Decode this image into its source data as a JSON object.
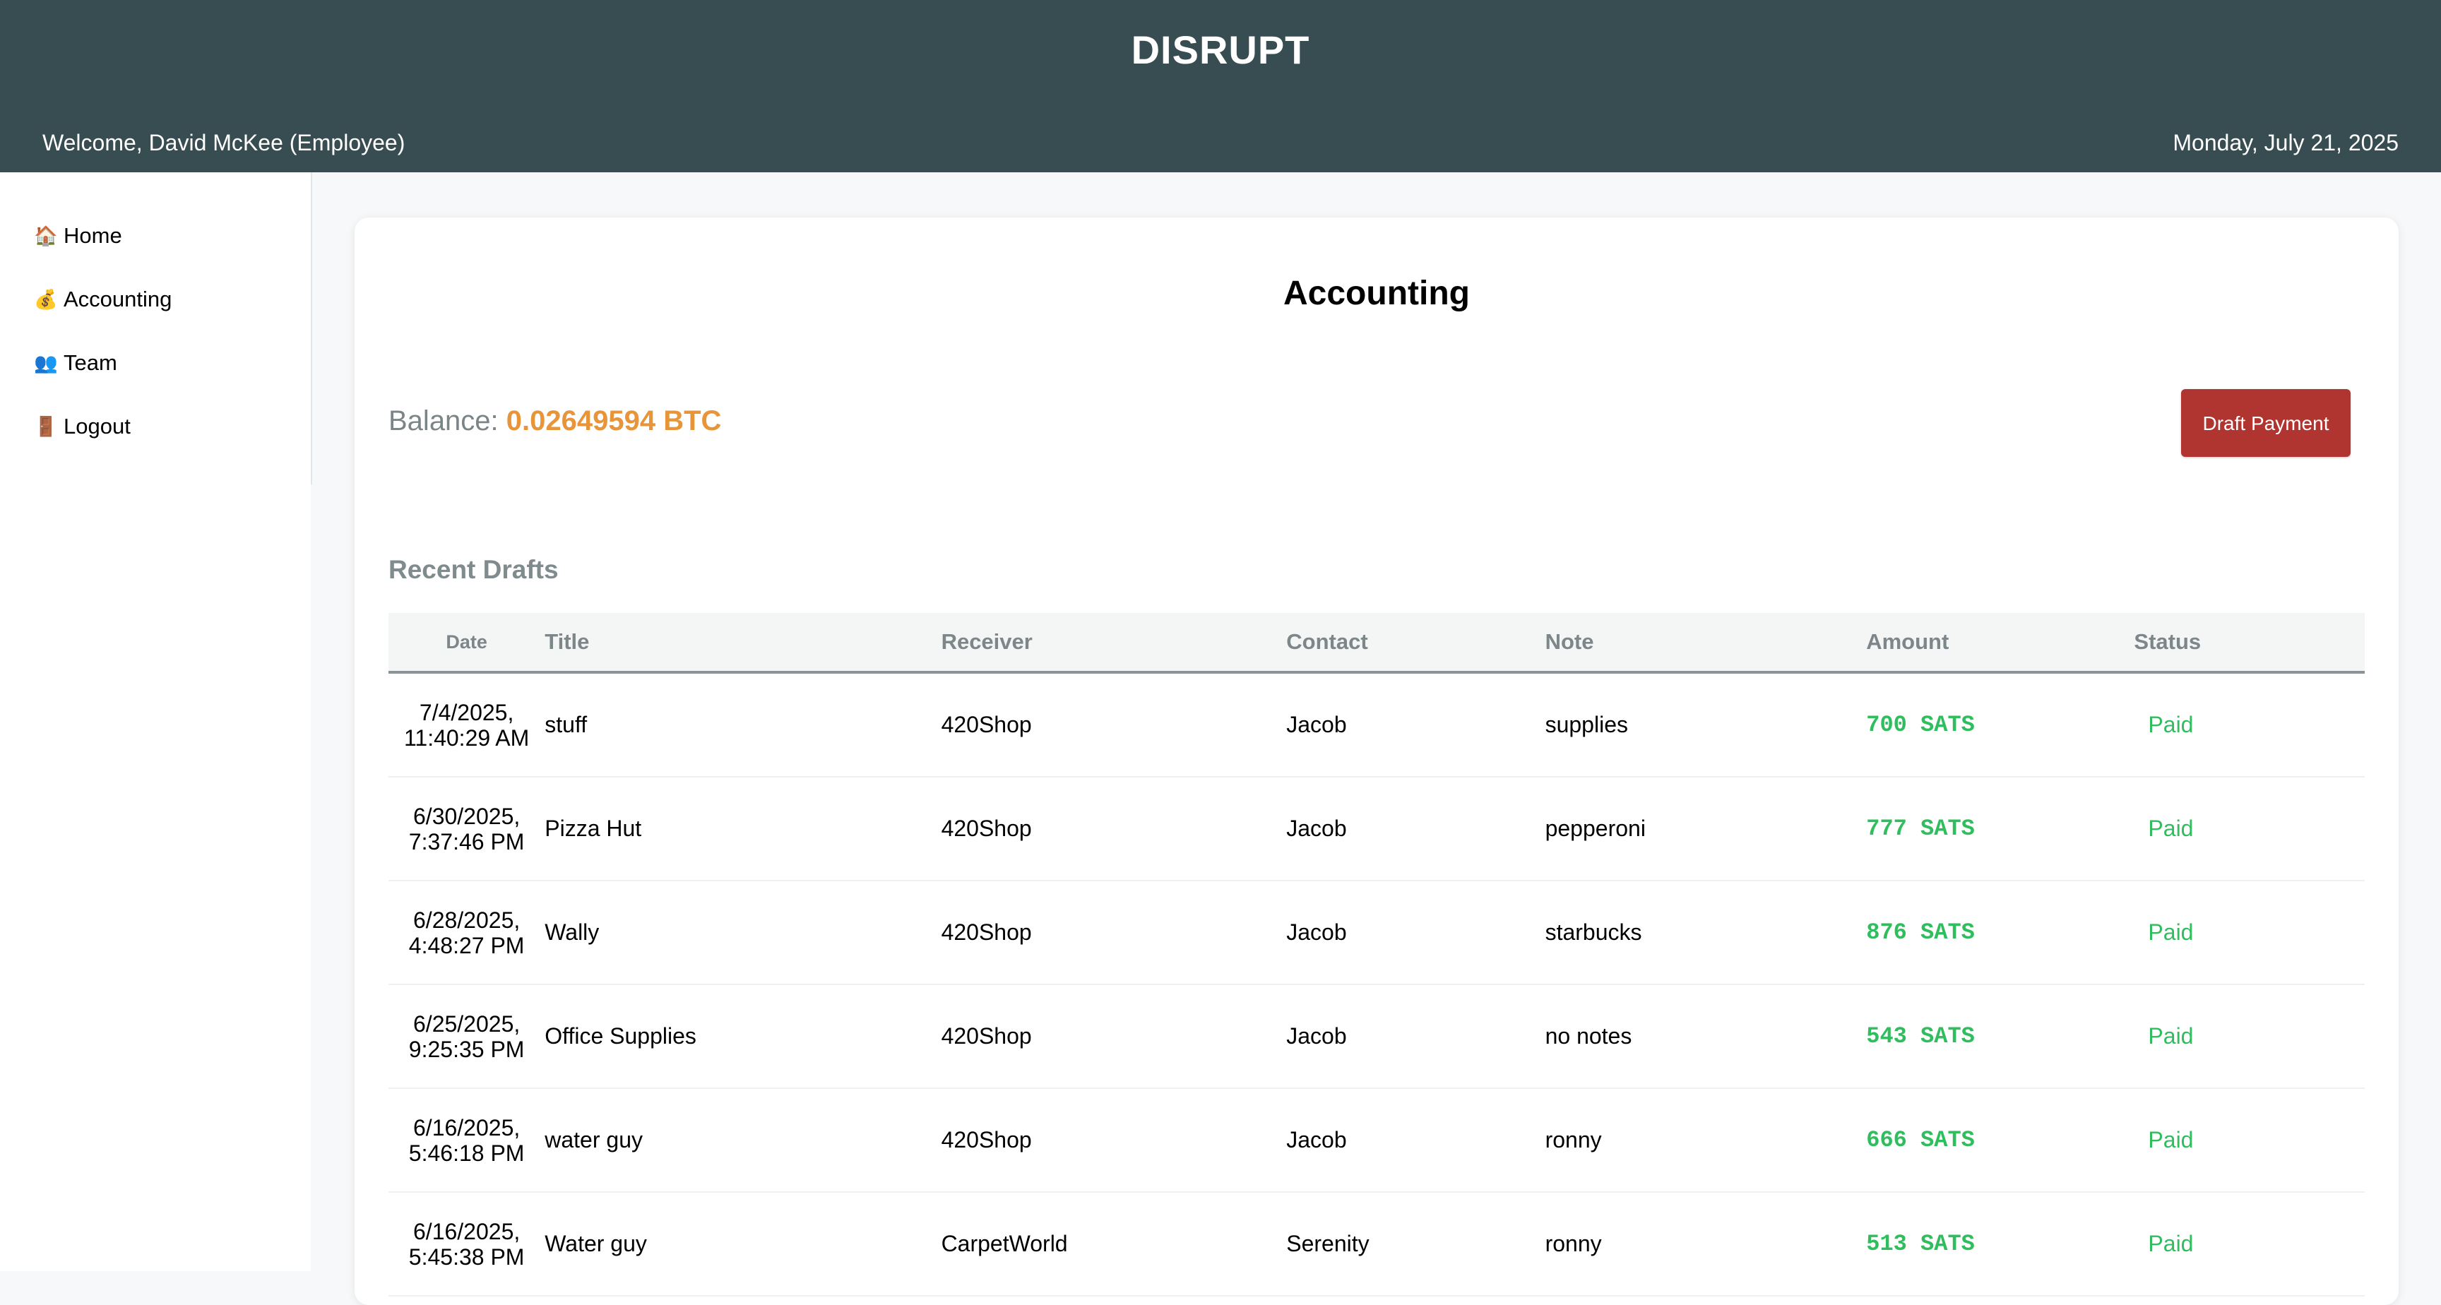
{
  "header": {
    "app_title": "DISRUPT",
    "welcome": "Welcome, David McKee (Employee)",
    "date": "Monday, July 21, 2025"
  },
  "sidebar": {
    "items": [
      {
        "icon": "🏠",
        "icon_name": "home-icon",
        "label": "Home"
      },
      {
        "icon": "💰",
        "icon_name": "money-bag-icon",
        "label": "Accounting"
      },
      {
        "icon": "👥",
        "icon_name": "team-icon",
        "label": "Team"
      },
      {
        "icon": "🚪",
        "icon_name": "door-icon",
        "label": "Logout"
      }
    ]
  },
  "main": {
    "title": "Accounting",
    "balance_label": "Balance:",
    "balance_value": "0.02649594 BTC",
    "draft_button": "Draft Payment",
    "section_title": "Recent Drafts",
    "table": {
      "headers": [
        "Date",
        "Title",
        "Receiver",
        "Contact",
        "Note",
        "Amount",
        "Status"
      ],
      "rows": [
        {
          "date": "7/4/2025, 11:40:29 AM",
          "title": "stuff",
          "receiver": "420Shop",
          "contact": "Jacob",
          "note": "supplies",
          "amount": "700 SATS",
          "status": "Paid"
        },
        {
          "date": "6/30/2025, 7:37:46 PM",
          "title": "Pizza Hut",
          "receiver": "420Shop",
          "contact": "Jacob",
          "note": "pepperoni",
          "amount": "777 SATS",
          "status": "Paid"
        },
        {
          "date": "6/28/2025, 4:48:27 PM",
          "title": "Wally",
          "receiver": "420Shop",
          "contact": "Jacob",
          "note": "starbucks",
          "amount": "876 SATS",
          "status": "Paid"
        },
        {
          "date": "6/25/2025, 9:25:35 PM",
          "title": "Office Supplies",
          "receiver": "420Shop",
          "contact": "Jacob",
          "note": "no notes",
          "amount": "543 SATS",
          "status": "Paid"
        },
        {
          "date": "6/16/2025, 5:46:18 PM",
          "title": "water guy",
          "receiver": "420Shop",
          "contact": "Jacob",
          "note": "ronny",
          "amount": "666 SATS",
          "status": "Paid"
        },
        {
          "date": "6/16/2025, 5:45:38 PM",
          "title": "Water guy",
          "receiver": "CarpetWorld",
          "contact": "Serenity",
          "note": "ronny",
          "amount": "513 SATS",
          "status": "Paid"
        }
      ]
    }
  },
  "colors": {
    "header_bg": "#384d52",
    "balance_accent": "#e8953a",
    "draft_button_bg": "#b03430",
    "paid_green": "#2fbd5e"
  }
}
